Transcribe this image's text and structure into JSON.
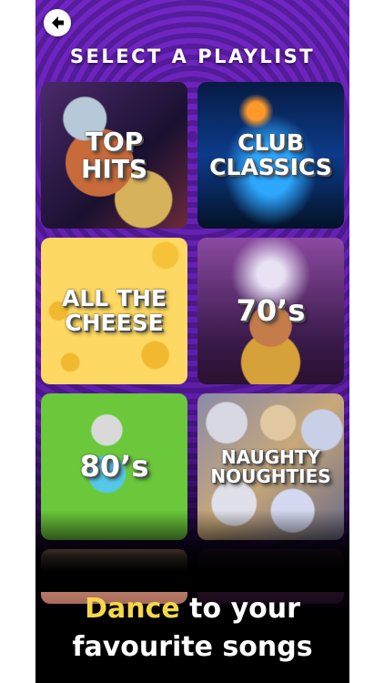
{
  "header": {
    "title": "SELECT A PLAYLIST"
  },
  "playlists": [
    {
      "line1": "TOP",
      "line2": "HITS"
    },
    {
      "line1": "CLUB",
      "line2": "CLASSICS"
    },
    {
      "line1": "ALL THE",
      "line2": "CHEESE"
    },
    {
      "line1": "70’s"
    },
    {
      "line1": "80’s"
    },
    {
      "line1": "NAUGHTY",
      "line2": "NOUGHTIES"
    }
  ],
  "tagline": {
    "highlight": "Dance",
    "rest_line1": " to your",
    "line2": "favourite songs"
  },
  "colors": {
    "accent": "#f5d849",
    "background": "#6a25bd"
  },
  "icons": {
    "back": "back-arrow-icon"
  }
}
